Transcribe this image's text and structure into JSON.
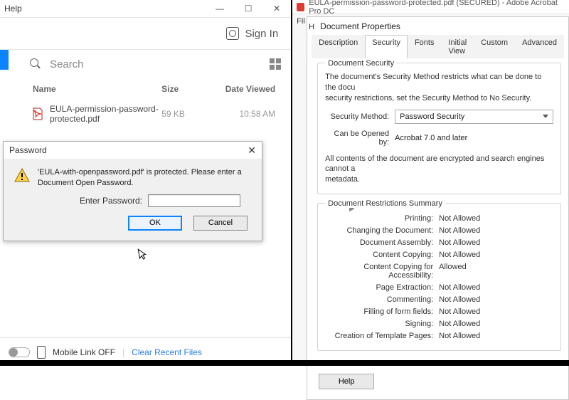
{
  "left": {
    "menu_help": "Help",
    "signin": "Sign In",
    "search_placeholder": "Search",
    "columns": {
      "name": "Name",
      "size": "Size",
      "viewed": "Date Viewed"
    },
    "file": {
      "name": "EULA-permission-password-protected.pdf",
      "size": "59 KB",
      "viewed": "10:58 AM"
    },
    "footer": {
      "mobile": "Mobile Link OFF",
      "clear": "Clear Recent Files"
    }
  },
  "dialog": {
    "title": "Password",
    "message": "'EULA-with-openpassword.pdf' is protected. Please enter a Document Open Password.",
    "label": "Enter Password:",
    "ok": "OK",
    "cancel": "Cancel"
  },
  "right": {
    "titlebar": "EULA-permission-password-protected.pdf (SECURED) - Adobe Acrobat Pro DC",
    "file_menu": "Fil",
    "h_menu": "H",
    "props_title": "Document Properties",
    "tabs": [
      "Description",
      "Security",
      "Fonts",
      "Initial View",
      "Custom",
      "Advanced"
    ],
    "active_tab": "Security",
    "docsec_title": "Document Security",
    "docsec_desc": "The document's Security Method restricts what can be done to the docu\nsecurity restrictions, set the Security Method to No Security.",
    "sec_method_label": "Security Method:",
    "sec_method_value": "Password Security",
    "opened_label": "Can be Opened by:",
    "opened_value": "Acrobat 7.0 and later",
    "encrypted_note": "All contents of the document are encrypted and search engines cannot a\nmetadata.",
    "restr_title": "Document Restrictions Summary",
    "restrictions": [
      {
        "k": "Printing:",
        "v": "Not Allowed"
      },
      {
        "k": "Changing the Document:",
        "v": "Not Allowed"
      },
      {
        "k": "Document Assembly:",
        "v": "Not Allowed"
      },
      {
        "k": "Content Copying:",
        "v": "Not Allowed"
      },
      {
        "k": "Content Copying for Accessibility:",
        "v": "Allowed"
      },
      {
        "k": "Page Extraction:",
        "v": "Not Allowed"
      },
      {
        "k": "Commenting:",
        "v": "Not Allowed"
      },
      {
        "k": "Filling of form fields:",
        "v": "Not Allowed"
      },
      {
        "k": "Signing:",
        "v": "Not Allowed"
      },
      {
        "k": "Creation of Template Pages:",
        "v": "Not Allowed"
      }
    ],
    "help": "Help"
  }
}
